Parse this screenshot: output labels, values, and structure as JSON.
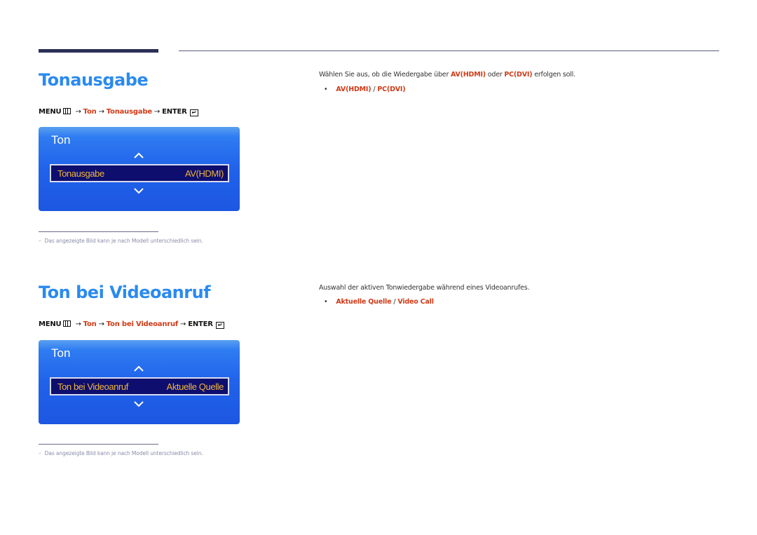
{
  "sections": [
    {
      "title": "Tonausgabe",
      "menu_path": {
        "menu": "MENU",
        "steps": [
          "Ton",
          "Tonausgabe"
        ],
        "enter": "ENTER"
      },
      "osd": {
        "title": "Ton",
        "item_label": "Tonausgabe",
        "item_value": "AV(HDMI)"
      },
      "note": "Das angezeigte Bild kann je nach Modell unterschiedlich sein.",
      "description": {
        "prefix": "Wählen Sie aus, ob die Wiedergabe über ",
        "option1": "AV(HDMI)",
        "middle": " oder ",
        "option2": "PC(DVI)",
        "suffix": " erfolgen soll."
      },
      "options": [
        "AV(HDMI)",
        "PC(DVI)"
      ]
    },
    {
      "title": "Ton bei Videoanruf",
      "menu_path": {
        "menu": "MENU",
        "steps": [
          "Ton",
          "Ton bei Videoanruf"
        ],
        "enter": "ENTER"
      },
      "osd": {
        "title": "Ton",
        "item_label": "Ton bei Videoanruf",
        "item_value": "Aktuelle Quelle"
      },
      "note": "Das angezeigte Bild kann je nach Modell unterschiedlich sein.",
      "description": {
        "text": "Auswahl der aktiven Tonwiedergabe während eines Videoanrufes."
      },
      "options": [
        "Aktuelle Quelle",
        "Video Call"
      ]
    }
  ],
  "symbols": {
    "arrow": "→",
    "bullet": "•",
    "slash": "/",
    "dash": "–",
    "enter_glyph": "↵"
  },
  "colors": {
    "heading": "#2a8af0",
    "accent_red": "#d03a17",
    "osd_blue": "#2062ea",
    "osd_row": "#0d0e6e",
    "osd_text": "#f0b53a"
  }
}
